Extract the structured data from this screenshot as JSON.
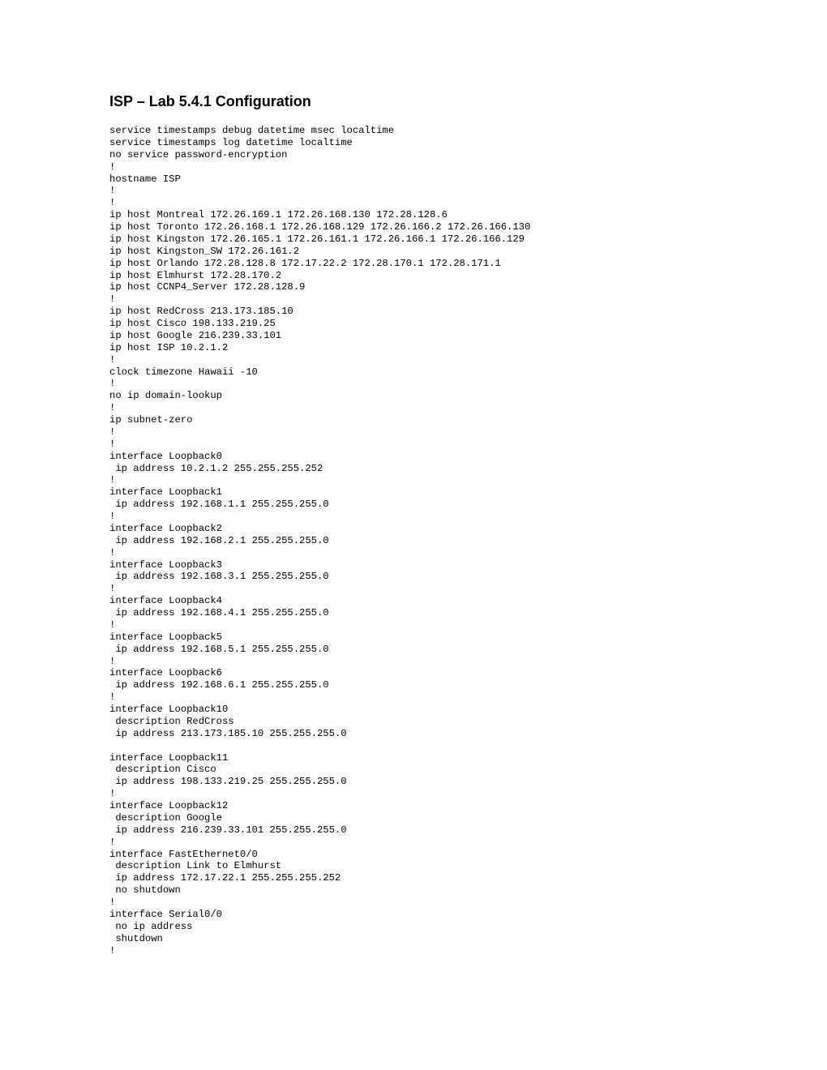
{
  "title": "ISP – Lab 5.4.1 Configuration",
  "config": "service timestamps debug datetime msec localtime\nservice timestamps log datetime localtime\nno service password-encryption\n!\nhostname ISP\n!\n!\nip host Montreal 172.26.169.1 172.26.168.130 172.28.128.6\nip host Toronto 172.26.168.1 172.26.168.129 172.26.166.2 172.26.166.130\nip host Kingston 172.26.165.1 172.26.161.1 172.26.166.1 172.26.166.129\nip host Kingston_SW 172.26.161.2\nip host Orlando 172.28.128.8 172.17.22.2 172.28.170.1 172.28.171.1\nip host Elmhurst 172.28.170.2\nip host CCNP4_Server 172.28.128.9\n!\nip host RedCross 213.173.185.10\nip host Cisco 198.133.219.25\nip host Google 216.239.33.101\nip host ISP 10.2.1.2\n!\nclock timezone Hawaii -10\n!\nno ip domain-lookup\n!\nip subnet-zero\n!\n!\ninterface Loopback0\n ip address 10.2.1.2 255.255.255.252\n!\ninterface Loopback1\n ip address 192.168.1.1 255.255.255.0\n!\ninterface Loopback2\n ip address 192.168.2.1 255.255.255.0\n!\ninterface Loopback3\n ip address 192.168.3.1 255.255.255.0\n!\ninterface Loopback4\n ip address 192.168.4.1 255.255.255.0\n!\ninterface Loopback5\n ip address 192.168.5.1 255.255.255.0\n!\ninterface Loopback6\n ip address 192.168.6.1 255.255.255.0\n!\ninterface Loopback10\n description RedCross\n ip address 213.173.185.10 255.255.255.0\n\ninterface Loopback11\n description Cisco\n ip address 198.133.219.25 255.255.255.0\n!\ninterface Loopback12\n description Google\n ip address 216.239.33.101 255.255.255.0\n!\ninterface FastEthernet0/0\n description Link to Elmhurst\n ip address 172.17.22.1 255.255.255.252\n no shutdown\n!\ninterface Serial0/0\n no ip address\n shutdown\n!"
}
